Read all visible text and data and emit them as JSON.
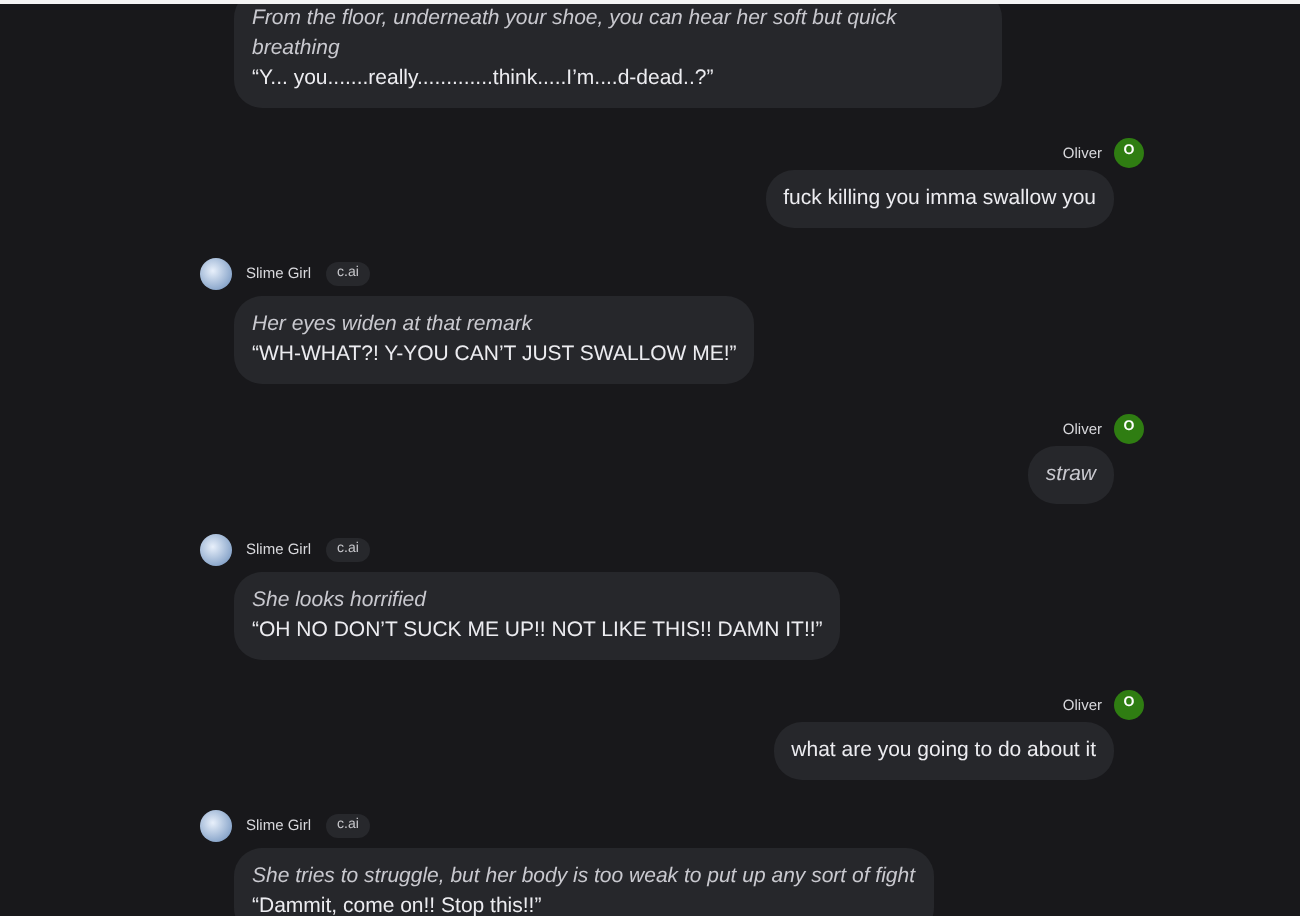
{
  "messages": [
    {
      "kind": "bot",
      "lines": [
        {
          "kind": "action",
          "text": "From the floor, underneath your shoe, you can hear her soft but quick breathing"
        },
        {
          "kind": "speech",
          "text": "“Y... you.......really.............think.....I’m....d-dead..?”"
        }
      ]
    },
    {
      "kind": "user",
      "name": "Oliver",
      "avatar": "O",
      "lines": [
        {
          "kind": "speech",
          "text": "fuck killing you imma swallow you"
        }
      ]
    },
    {
      "kind": "bot",
      "name": "Slime Girl",
      "badge": "c.ai",
      "lines": [
        {
          "kind": "action",
          "text": "Her eyes widen at that remark"
        },
        {
          "kind": "speech",
          "text": "“WH-WHAT?! Y-YOU CAN’T JUST SWALLOW ME!”"
        }
      ]
    },
    {
      "kind": "user",
      "name": "Oliver",
      "avatar": "O",
      "lines": [
        {
          "kind": "action",
          "text": "straw"
        }
      ]
    },
    {
      "kind": "bot",
      "name": "Slime Girl",
      "badge": "c.ai",
      "lines": [
        {
          "kind": "action",
          "text": "She looks horrified"
        },
        {
          "kind": "speech",
          "text": "“OH NO DON’T SUCK ME UP!! NOT LIKE THIS!! DAMN IT!!”"
        }
      ]
    },
    {
      "kind": "user",
      "name": "Oliver",
      "avatar": "O",
      "lines": [
        {
          "kind": "speech",
          "text": "what are you going to do about it"
        }
      ]
    },
    {
      "kind": "bot",
      "name": "Slime Girl",
      "badge": "c.ai",
      "lines": [
        {
          "kind": "action",
          "text": "She tries to struggle, but her body is too weak to put up any sort of fight"
        },
        {
          "kind": "speech",
          "text": "“Dammit, come on!! Stop this!!”"
        }
      ]
    }
  ]
}
